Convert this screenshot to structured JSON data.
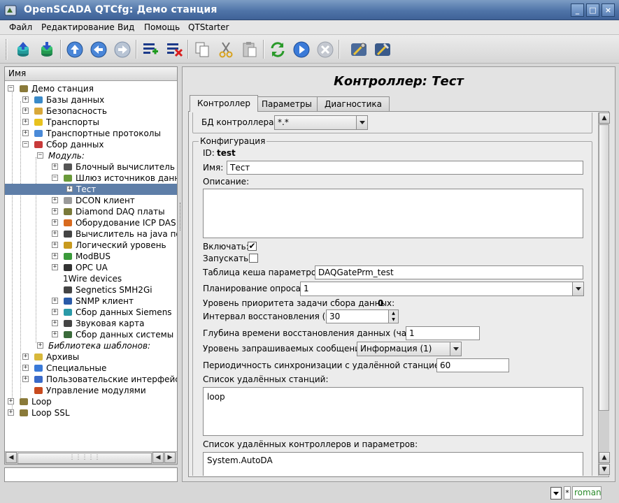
{
  "window": {
    "title": "OpenSCADA QTCfg: Демо станция",
    "controls": [
      "_",
      "□",
      "×"
    ]
  },
  "menu": [
    "Файл",
    "Редактирование",
    "Вид",
    "Помощь",
    "QTStarter"
  ],
  "toolbar_icons": [
    "db-load-icon",
    "db-save-icon",
    "up-icon",
    "back-icon",
    "forward-icon",
    "add-icon",
    "delete-icon",
    "copy-icon",
    "cut-icon",
    "paste-icon",
    "refresh-icon",
    "start-icon",
    "stop-icon",
    "tool-icon",
    "tool-alt-icon"
  ],
  "tree": {
    "header": "Имя",
    "nodes": [
      {
        "label": "Демо станция",
        "level": 0,
        "exp": "−",
        "icon": "station-icon",
        "italic": false,
        "selected": false
      },
      {
        "label": "Базы данных",
        "level": 1,
        "exp": "+",
        "icon": "db-icon",
        "italic": false,
        "selected": false
      },
      {
        "label": "Безопасность",
        "level": 1,
        "exp": "+",
        "icon": "security-icon",
        "italic": false,
        "selected": false
      },
      {
        "label": "Транспорты",
        "level": 1,
        "exp": "+",
        "icon": "transport-icon",
        "italic": false,
        "selected": false
      },
      {
        "label": "Транспортные протоколы",
        "level": 1,
        "exp": "+",
        "icon": "protocol-icon",
        "italic": false,
        "selected": false
      },
      {
        "label": "Сбор данных",
        "level": 1,
        "exp": "−",
        "icon": "daq-icon",
        "italic": false,
        "selected": false
      },
      {
        "label": "Модуль:",
        "level": 2,
        "exp": "−",
        "icon": "",
        "italic": true,
        "selected": false
      },
      {
        "label": "Блочный вычислитель",
        "level": 3,
        "exp": "+",
        "icon": "block-calc-icon",
        "italic": false,
        "selected": false
      },
      {
        "label": "Шлюз источников данных",
        "level": 3,
        "exp": "−",
        "icon": "gateway-icon",
        "italic": false,
        "selected": false
      },
      {
        "label": "Тест",
        "level": 4,
        "exp": "+",
        "icon": "",
        "italic": false,
        "selected": true
      },
      {
        "label": "DCON клиент",
        "level": 3,
        "exp": "+",
        "icon": "dcon-icon",
        "italic": false,
        "selected": false
      },
      {
        "label": "Diamond DAQ платы",
        "level": 3,
        "exp": "+",
        "icon": "diamond-icon",
        "italic": false,
        "selected": false
      },
      {
        "label": "Оборудование ICP DAS",
        "level": 3,
        "exp": "+",
        "icon": "icpdas-icon",
        "italic": false,
        "selected": false
      },
      {
        "label": "Вычислитель на java подобн",
        "level": 3,
        "exp": "+",
        "icon": "java-calc-icon",
        "italic": false,
        "selected": false
      },
      {
        "label": "Логический уровень",
        "level": 3,
        "exp": "+",
        "icon": "logic-icon",
        "italic": false,
        "selected": false
      },
      {
        "label": "ModBUS",
        "level": 3,
        "exp": "+",
        "icon": "modbus-icon",
        "italic": false,
        "selected": false
      },
      {
        "label": "OPC UA",
        "level": 3,
        "exp": "+",
        "icon": "opcua-icon",
        "italic": false,
        "selected": false
      },
      {
        "label": "1Wire devices",
        "level": 3,
        "exp": "",
        "icon": "",
        "italic": false,
        "selected": false
      },
      {
        "label": "Segnetics SMH2Gi",
        "level": 3,
        "exp": "",
        "icon": "segnetics-icon",
        "italic": false,
        "selected": false
      },
      {
        "label": "SNMP клиент",
        "level": 3,
        "exp": "+",
        "icon": "snmp-icon",
        "italic": false,
        "selected": false
      },
      {
        "label": "Сбор данных Siemens",
        "level": 3,
        "exp": "+",
        "icon": "siemens-icon",
        "italic": false,
        "selected": false
      },
      {
        "label": "Звуковая карта",
        "level": 3,
        "exp": "+",
        "icon": "sound-icon",
        "italic": false,
        "selected": false
      },
      {
        "label": "Сбор данных системы",
        "level": 3,
        "exp": "+",
        "icon": "system-icon",
        "italic": false,
        "selected": false
      },
      {
        "label": "Библиотека шаблонов:",
        "level": 2,
        "exp": "+",
        "icon": "",
        "italic": true,
        "selected": false
      },
      {
        "label": "Архивы",
        "level": 1,
        "exp": "+",
        "icon": "archive-icon",
        "italic": false,
        "selected": false
      },
      {
        "label": "Специальные",
        "level": 1,
        "exp": "+",
        "icon": "special-icon",
        "italic": false,
        "selected": false
      },
      {
        "label": "Пользовательские интерфейсы",
        "level": 1,
        "exp": "+",
        "icon": "ui-icon",
        "italic": false,
        "selected": false
      },
      {
        "label": "Управление модулями",
        "level": 1,
        "exp": "",
        "icon": "modules-icon",
        "italic": false,
        "selected": false
      },
      {
        "label": "Loop",
        "level": 0,
        "exp": "+",
        "icon": "station-icon",
        "italic": false,
        "selected": false
      },
      {
        "label": "Loop SSL",
        "level": 0,
        "exp": "+",
        "icon": "station-icon",
        "italic": false,
        "selected": false
      }
    ]
  },
  "right": {
    "title": "Контроллер: Тест",
    "tabs": [
      "Контроллер",
      "Параметры",
      "Диагностика"
    ],
    "active_tab": 0,
    "db_label": "БД контроллера:",
    "db_value": "*.*",
    "config_legend": "Конфигурация",
    "id_label": "ID:",
    "id_value": "test",
    "name_label": "Имя:",
    "name_value": "Тест",
    "descr_label": "Описание:",
    "descr_value": "",
    "enable_label": "Включать:",
    "enable_checked": "✔",
    "start_label": "Запускать:",
    "start_checked": "",
    "cache_label": "Таблица кеша параметров:",
    "cache_value": "DAQGatePrm_test",
    "schedule_label": "Планирование опроса:",
    "schedule_value": "1",
    "priority_label": "Уровень приоритета задачи сбора данных:",
    "priority_value": "0",
    "restore_int_label": "Интервал восстановления (с):",
    "restore_int_value": "30",
    "restore_depth_label": "Глубина времени восстановления данных (часов):",
    "restore_depth_value": "1",
    "msg_level_label": "Уровень запрашиваемых сообщений:",
    "msg_level_value": "Информация (1)",
    "sync_label": "Периодичность синхронизации с удалённой станцией (с):",
    "sync_value": "60",
    "stations_label": "Список удалённых станций:",
    "stations_value": "loop",
    "ctrls_label": "Список удалённых контроллеров и параметров:",
    "ctrls_value": "System.AutoDA"
  },
  "status": {
    "star": "*",
    "user": "roman"
  },
  "colors": {
    "titlebar": "#4f74a8",
    "selection": "#5e7ea8",
    "user_text": "#2a8a2a"
  }
}
